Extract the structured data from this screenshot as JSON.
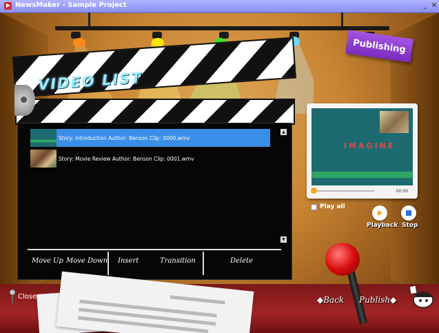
{
  "window": {
    "title": "NewsMaker - Sample Project",
    "min_label": "_",
    "close_label": "×"
  },
  "sign": {
    "publishing": "Publishing"
  },
  "clapper": {
    "title": "VIDEO LIST"
  },
  "video_list": {
    "rows": [
      {
        "text": "Story: Introduction   Author: Benson   Clip: 0000.wmv",
        "selected": true
      },
      {
        "text": "Story: Movie Review   Author: Benson   Clip: 0001.wmv",
        "selected": false
      }
    ],
    "scroll_up": "▲",
    "scroll_down": "▼"
  },
  "buttons": {
    "move_up": "Move Up",
    "move_down": "Move Down",
    "insert": "Insert",
    "transition": "Transition",
    "delete": "Delete"
  },
  "preview": {
    "logo_text": "IMAGINE",
    "time": "00:00",
    "play_all": "Play all",
    "playback": "Playback",
    "stop": "Stop"
  },
  "nav": {
    "close": "Close",
    "back": "Back",
    "publish": "Publish"
  },
  "colors": {
    "selected_row": "#3b8ee8",
    "sign": "#8c3ad0",
    "lever_ball": "#d90e0e"
  }
}
